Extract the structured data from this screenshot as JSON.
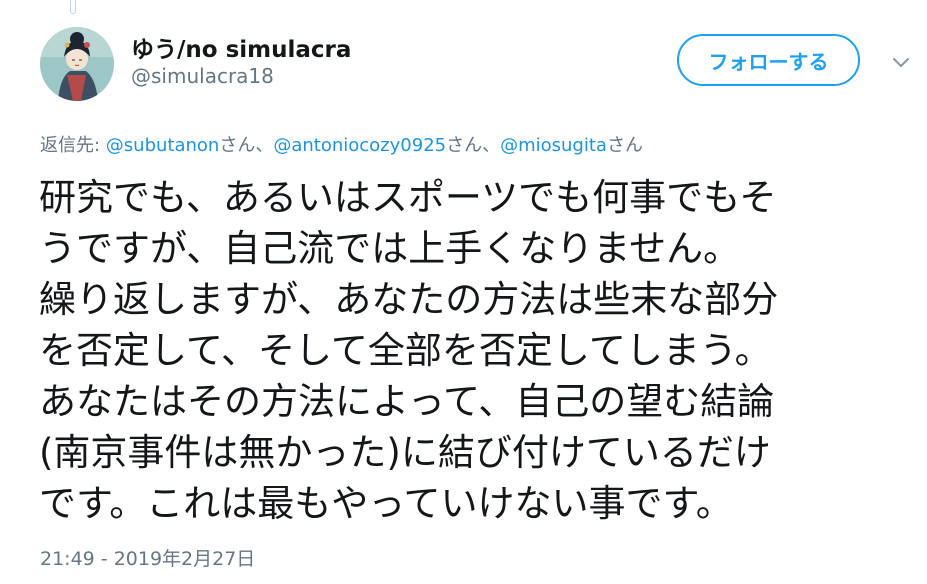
{
  "user": {
    "display_name": "ゆう/no simulacra",
    "handle": "@simulacra18"
  },
  "follow_button": {
    "label": "フォローする"
  },
  "reply_context": {
    "prefix": "返信先: ",
    "mentions": [
      {
        "handle": "@subutanon",
        "suffix": "さん、"
      },
      {
        "handle": "@antoniocozy0925",
        "suffix": "さん、"
      },
      {
        "handle": "@miosugita",
        "suffix": "さん"
      }
    ]
  },
  "tweet": {
    "lines": [
      "研究でも、あるいはスポーツでも何事でもそ",
      "うですが、自己流では上手くなりません。",
      "繰り返しますが、あなたの方法は些末な部分",
      "を否定して、そして全部を否定してしまう。",
      "あなたはその方法によって、自己の望む結論",
      "(南京事件は無かった)に結び付けているだけ",
      "です。これは最もやっていけない事です。"
    ],
    "timestamp": "21:49 - 2019年2月27日"
  },
  "icons": {
    "avatar": "avatar-illustration",
    "menu": "chevron-down-icon"
  },
  "colors": {
    "accent": "#1da1f2",
    "mention": "#1b95e0",
    "secondary_text": "#657786",
    "primary_text": "#14171a"
  }
}
